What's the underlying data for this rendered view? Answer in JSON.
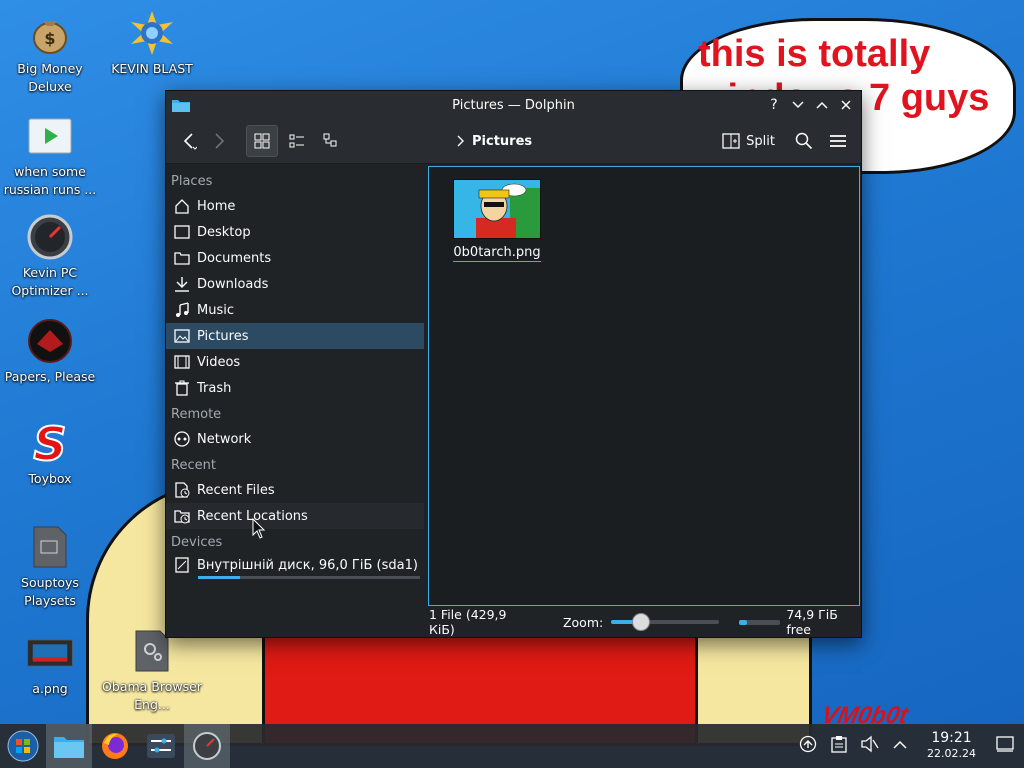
{
  "wallpaper": {
    "bubble_text": "this is totally\nwindows 7 guys",
    "signature": "VM0b0t"
  },
  "desktop_icons": [
    {
      "label": "Big Money Deluxe",
      "icon": "money-bag-icon"
    },
    {
      "label": "KEVIN BLAST",
      "icon": "kevin-blast-icon"
    },
    {
      "label": "when some russian runs ...",
      "icon": "video-file-icon"
    },
    {
      "label": "Kevin PC Optimizer ...",
      "icon": "gauge-icon"
    },
    {
      "label": "Papers, Please",
      "icon": "papers-please-icon"
    },
    {
      "label": "Toybox",
      "icon": "toybox-icon"
    },
    {
      "label": "Souptoys Playsets",
      "icon": "file-icon"
    },
    {
      "label": "a.png",
      "icon": "image-file-icon"
    },
    {
      "label": "Obama Browser Eng...",
      "icon": "settings-file-icon"
    }
  ],
  "window": {
    "title": "Pictures — Dolphin",
    "breadcrumb": "Pictures",
    "split_label": "Split",
    "title_buttons": [
      "?",
      "⌵",
      "⌃",
      "✕"
    ]
  },
  "places": {
    "section_places": "Places",
    "items": [
      {
        "label": "Home",
        "icon": "home-icon"
      },
      {
        "label": "Desktop",
        "icon": "desktop-icon"
      },
      {
        "label": "Documents",
        "icon": "documents-icon"
      },
      {
        "label": "Downloads",
        "icon": "downloads-icon"
      },
      {
        "label": "Music",
        "icon": "music-icon"
      },
      {
        "label": "Pictures",
        "icon": "pictures-icon",
        "selected": true
      },
      {
        "label": "Videos",
        "icon": "videos-icon"
      },
      {
        "label": "Trash",
        "icon": "trash-icon"
      }
    ],
    "section_remote": "Remote",
    "remote_items": [
      {
        "label": "Network",
        "icon": "network-icon"
      }
    ],
    "section_recent": "Recent",
    "recent_items": [
      {
        "label": "Recent Files",
        "icon": "recent-files-icon"
      },
      {
        "label": "Recent Locations",
        "icon": "recent-locations-icon"
      }
    ],
    "section_devices": "Devices",
    "devices": [
      {
        "label": "Внутрішній диск, 96,0 ГіБ (sda1)",
        "icon": "drive-icon",
        "used_fraction": 0.19
      }
    ]
  },
  "files": [
    {
      "name": "0b0tarch.png"
    }
  ],
  "statusbar": {
    "summary": "1 File (429,9 КіБ)",
    "zoom_label": "Zoom:",
    "free_space": "74,9 ГіБ free",
    "zoom_level": 0.25,
    "disk_used_fraction": 0.19
  },
  "taskbar": {
    "apps": [
      "start-orb-icon",
      "dolphin-icon",
      "firefox-icon",
      "system-settings-icon",
      "kevin-pc-optimizer-icon"
    ],
    "time": "19:21",
    "date": "22.02.24"
  },
  "colors": {
    "accent": "#3daee9",
    "window_bg": "#202326",
    "selection": "#2c4b63",
    "bubble_text": "#e0141f"
  }
}
